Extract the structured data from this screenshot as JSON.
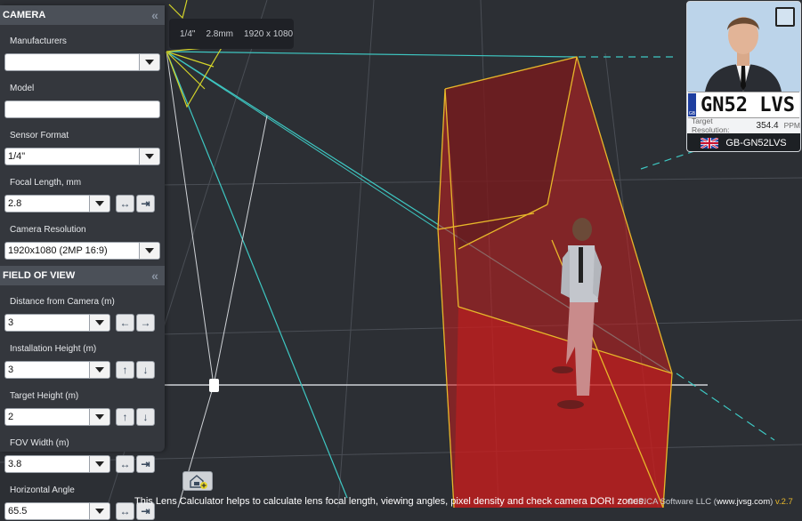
{
  "info_chip": {
    "sensor": "1/4\"",
    "focal": "2.8mm",
    "resolution": "1920 x 1080"
  },
  "camera_section": {
    "title": "CAMERA",
    "manufacturers_label": "Manufacturers",
    "manufacturers_value": "",
    "model_label": "Model",
    "model_value": "",
    "sensor_label": "Sensor Format",
    "sensor_value": "1/4\"",
    "focal_label": "Focal Length, mm",
    "focal_value": "2.8",
    "resolution_label": "Camera Resolution",
    "resolution_value": "1920x1080 (2MP 16:9)"
  },
  "fov_section": {
    "title": "FIELD OF VIEW",
    "distance_label": "Distance from Camera (m)",
    "distance_value": "3",
    "install_label": "Installation Height (m)",
    "install_value": "3",
    "target_label": "Target Height (m)",
    "target_value": "2",
    "width_label": "FOV Width (m)",
    "width_value": "3.8",
    "angle_label": "Horizontal Angle",
    "angle_value": "65.5"
  },
  "preview": {
    "plate_text": "GN52 LVS",
    "plate_badge": "GB",
    "target_res_label": "Target Resolution:",
    "target_res_value": "354.4",
    "target_res_unit": "PPM",
    "country": "GB-GN52LVS"
  },
  "footer": {
    "text": "This Lens Calculator helps to calculate lens focal length, viewing angles, pixel density and check camera DORI zones.",
    "copyright": "© IPICA Software LLC (",
    "link": "www.jvsg.com",
    "close": ")",
    "version": "v.2.7"
  },
  "colors": {
    "accent": "#e7b72a",
    "fov_fill": "#c81e1e",
    "beam": "#3ec7c2",
    "camera": "#d4d42a"
  },
  "icons": [
    "collapse-icon",
    "dropdown-arrow-icon",
    "arrow-left-icon",
    "arrow-right-icon",
    "arrow-up-icon",
    "arrow-down-icon",
    "expand-width-icon",
    "shrink-width-icon",
    "expand-icon",
    "home-camera-icon",
    "uk-flag-icon"
  ]
}
